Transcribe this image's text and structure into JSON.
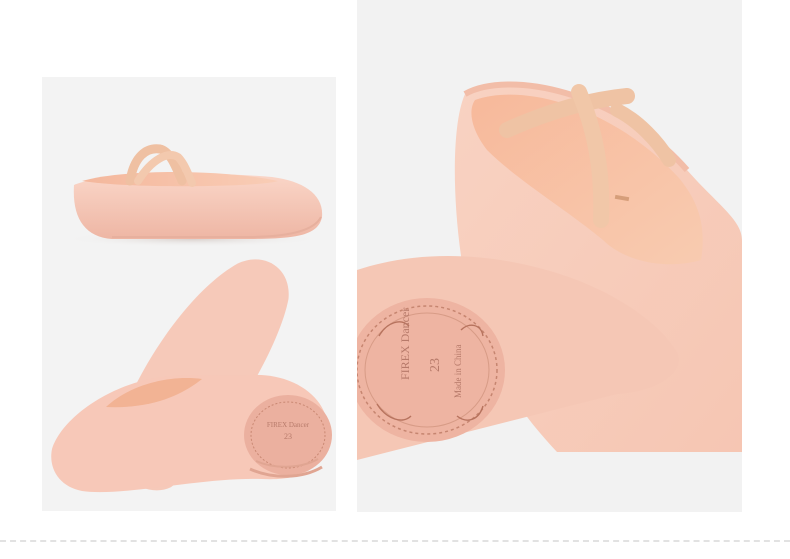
{
  "photo_set": {
    "background": "#ffffff",
    "panel_background": "#f3f3f3",
    "shoe_color": "#f7c9b9",
    "sole_color": "#e9b0a0",
    "elastic_color": "#f0c4a8",
    "sole_stamp": {
      "brand": "FIREX Dancer",
      "size": "23",
      "origin": "Made in China"
    }
  }
}
